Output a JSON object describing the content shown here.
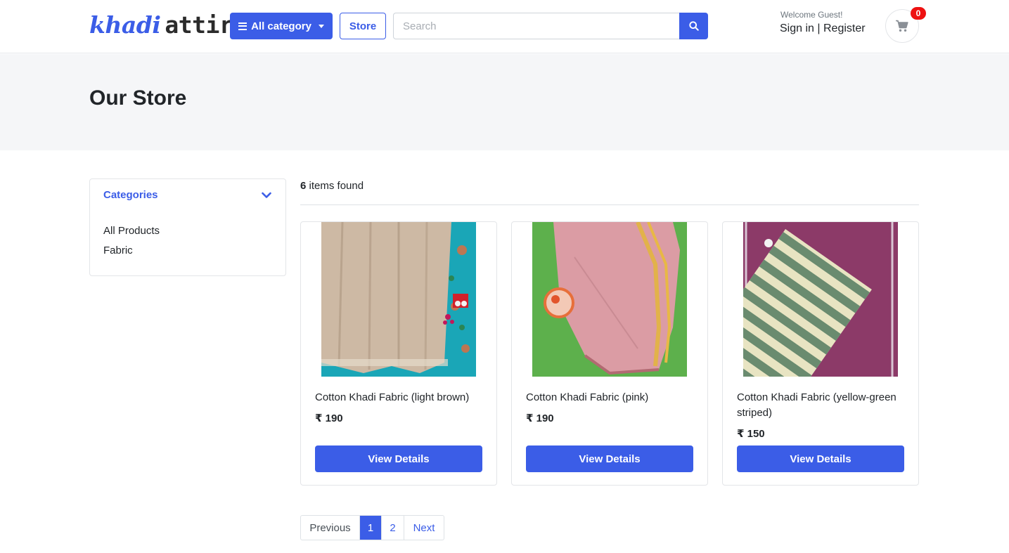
{
  "header": {
    "logo_part1": "khadi",
    "logo_part2": "attire",
    "category_button": "All category",
    "store_button": "Store",
    "search_placeholder": "Search",
    "welcome": "Welcome Guest!",
    "sign_in": "Sign in",
    "separator": "|",
    "register": "Register",
    "cart_count": "0"
  },
  "page": {
    "title": "Our Store"
  },
  "sidebar": {
    "heading": "Categories",
    "items": [
      "All Products",
      "Fabric"
    ]
  },
  "results": {
    "count": "6",
    "label": "items found"
  },
  "products": [
    {
      "name": "Cotton Khadi Fabric (light brown)",
      "currency": "₹",
      "price": "190",
      "button": "View Details"
    },
    {
      "name": "Cotton Khadi Fabric (pink)",
      "currency": "₹",
      "price": "190",
      "button": "View Details"
    },
    {
      "name": "Cotton Khadi Fabric (yellow-green striped)",
      "currency": "₹",
      "price": "150",
      "button": "View Details"
    }
  ],
  "pagination": {
    "previous": "Previous",
    "pages": [
      "1",
      "2"
    ],
    "current": "1",
    "next": "Next"
  },
  "colors": {
    "primary": "#3b5de7",
    "badge": "#ee1111",
    "band": "#f5f6f8"
  }
}
